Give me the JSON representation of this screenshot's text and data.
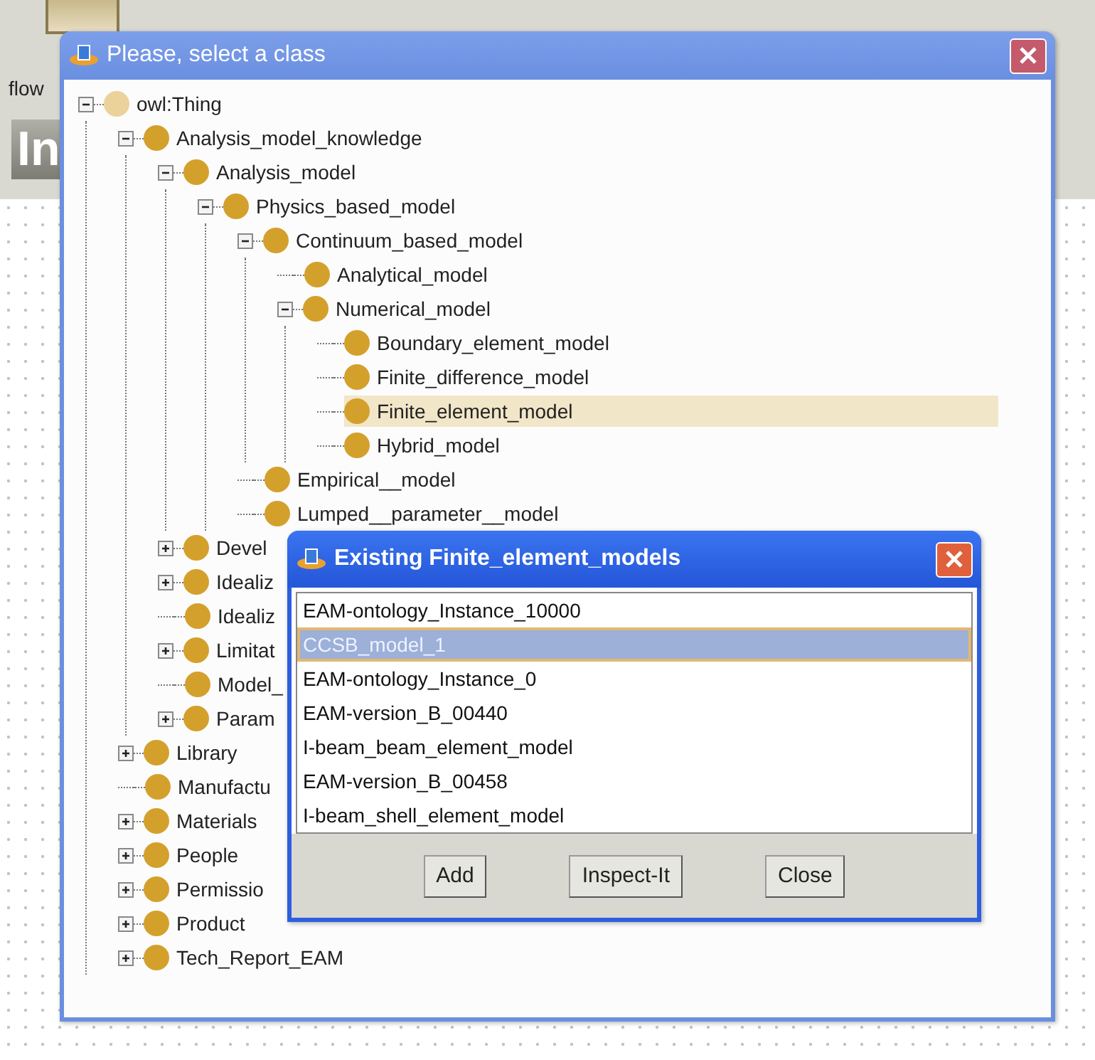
{
  "background_app": {
    "tab_label": "flow",
    "heading": "In"
  },
  "class_dialog": {
    "title": "Please, select a class",
    "tree": [
      {
        "label": "owl:Thing",
        "expanded": true,
        "selected": false,
        "children": [
          {
            "label": "Analysis_model_knowledge",
            "expanded": true,
            "selected": false,
            "children": [
              {
                "label": "Analysis_model",
                "expanded": true,
                "selected": false,
                "children": [
                  {
                    "label": "Physics_based_model",
                    "expanded": true,
                    "selected": false,
                    "children": [
                      {
                        "label": "Continuum_based_model",
                        "expanded": true,
                        "selected": false,
                        "children": [
                          {
                            "label": "Analytical_model",
                            "selected": false
                          },
                          {
                            "label": "Numerical_model",
                            "expanded": true,
                            "selected": false,
                            "children": [
                              {
                                "label": "Boundary_element_model",
                                "selected": false
                              },
                              {
                                "label": "Finite_difference_model",
                                "selected": false
                              },
                              {
                                "label": "Finite_element_model",
                                "selected": true
                              },
                              {
                                "label": "Hybrid_model",
                                "selected": false
                              }
                            ]
                          }
                        ]
                      },
                      {
                        "label": "Empirical__model",
                        "selected": false
                      },
                      {
                        "label": "Lumped__parameter__model",
                        "selected": false
                      }
                    ]
                  }
                ]
              },
              {
                "label": "Devel",
                "expanded": false,
                "selected": false
              },
              {
                "label": "Idealiz",
                "expanded": false,
                "selected": false
              },
              {
                "label": "Idealiz",
                "selected": false
              },
              {
                "label": "Limitat",
                "expanded": false,
                "selected": false
              },
              {
                "label": "Model_",
                "selected": false
              },
              {
                "label": "Param",
                "expanded": false,
                "selected": false
              }
            ]
          },
          {
            "label": "Library",
            "expanded": false,
            "selected": false
          },
          {
            "label": "Manufactu",
            "selected": false
          },
          {
            "label": "Materials",
            "expanded": false,
            "selected": false
          },
          {
            "label": "People",
            "expanded": false,
            "selected": false
          },
          {
            "label": "Permissio",
            "expanded": false,
            "selected": false
          },
          {
            "label": "Product",
            "expanded": false,
            "selected": false
          },
          {
            "label": "Tech_Report_EAM",
            "expanded": false,
            "selected": false
          }
        ]
      }
    ]
  },
  "instances_dialog": {
    "title": "Existing Finite_element_models",
    "items": [
      {
        "label": "EAM-ontology_Instance_10000",
        "selected": false
      },
      {
        "label": "CCSB_model_1",
        "selected": true
      },
      {
        "label": "EAM-ontology_Instance_0",
        "selected": false
      },
      {
        "label": "EAM-version_B_00440",
        "selected": false
      },
      {
        "label": "I-beam_beam_element_model",
        "selected": false
      },
      {
        "label": "EAM-version_B_00458",
        "selected": false
      },
      {
        "label": "I-beam_shell_element_model",
        "selected": false
      }
    ],
    "buttons": [
      "Add",
      "Inspect-It",
      "Close"
    ]
  }
}
